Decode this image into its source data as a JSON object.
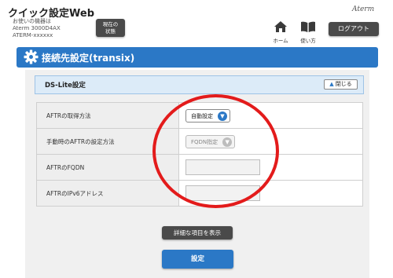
{
  "header": {
    "app_title": "クイック設定Web",
    "device_lines": [
      "お使いの機器は",
      "Aterm 3000D4AX",
      "ATERM-xxxxxx"
    ],
    "status_button": [
      "現在の",
      "状態"
    ],
    "home_label": "ホーム",
    "guide_label": "使い方",
    "logout_label": "ログアウト",
    "brand": "Aterm"
  },
  "page": {
    "title": "接続先設定(transix)"
  },
  "section": {
    "title": "DS-Lite設定",
    "collapse_label": "閉じる"
  },
  "rows": [
    {
      "label": "AFTRの取得方法",
      "value": "自動設定",
      "control": "select"
    },
    {
      "label": "手動時のAFTRの設定方法",
      "value": "FQDN指定",
      "control": "select-disabled"
    },
    {
      "label": "AFTRのFQDN",
      "value": "",
      "control": "input-disabled"
    },
    {
      "label": "AFTRのIPv6アドレス",
      "value": "",
      "control": "input-disabled"
    }
  ],
  "buttons": {
    "show_details": "詳細な項目を表示",
    "submit": "設定"
  },
  "colors": {
    "accent_blue": "#2b78c6",
    "dark_button": "#4a4a4a",
    "annotation_red": "#e31b1b"
  }
}
